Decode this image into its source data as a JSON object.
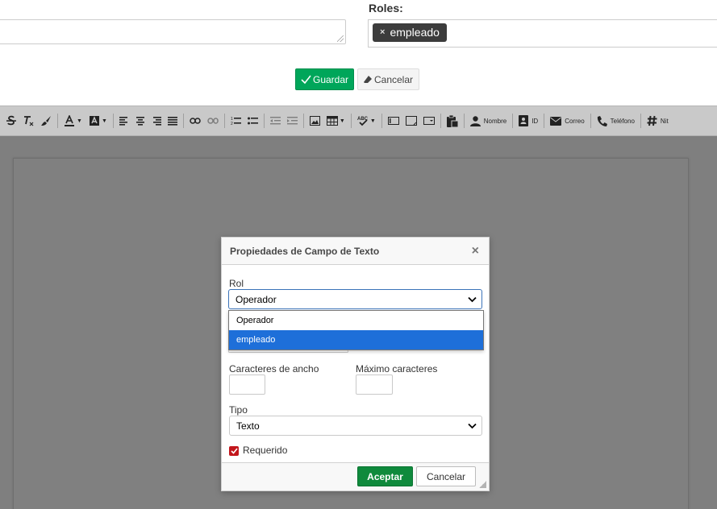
{
  "form": {
    "roles_label": "Roles:",
    "role_tag": {
      "remove": "×",
      "label": "empleado"
    },
    "save_label": "Guardar",
    "cancel_label": "Cancelar"
  },
  "toolbar": {
    "items": [
      {
        "icon": "strikethrough-icon"
      },
      {
        "icon": "remove-format-icon"
      },
      {
        "icon": "copy-format-icon"
      },
      {
        "icon": "text-color-icon"
      },
      {
        "icon": "background-color-icon"
      },
      {
        "icon": "align-left-icon"
      },
      {
        "icon": "align-center-icon"
      },
      {
        "icon": "align-right-icon"
      },
      {
        "icon": "align-justify-icon"
      },
      {
        "icon": "link-icon"
      },
      {
        "icon": "unlink-icon"
      },
      {
        "icon": "numbered-list-icon"
      },
      {
        "icon": "bulleted-list-icon"
      },
      {
        "icon": "decrease-indent-icon"
      },
      {
        "icon": "increase-indent-icon"
      },
      {
        "icon": "image-icon"
      },
      {
        "icon": "table-icon"
      },
      {
        "icon": "spellcheck-icon"
      },
      {
        "icon": "text-field-icon"
      },
      {
        "icon": "textarea-icon"
      },
      {
        "icon": "select-field-icon"
      },
      {
        "icon": "paste-icon"
      }
    ],
    "labeled": {
      "nombre": "Nombre",
      "id": "ID",
      "correo": "Correo",
      "telefono": "Teléfono",
      "nit": "Nit"
    }
  },
  "dialog": {
    "title": "Propiedades de Campo de Texto",
    "close": "×",
    "rol_label": "Rol",
    "rol_value": "Operador",
    "rol_options": [
      "Operador",
      "empleado"
    ],
    "rol_highlighted": "empleado",
    "width_label": "Caracteres de ancho",
    "max_label": "Máximo caracteres",
    "tipo_label": "Tipo",
    "tipo_value": "Texto",
    "required_label": "Requerido",
    "required_checked": true,
    "accept_label": "Aceptar",
    "cancel_label": "Cancelar"
  },
  "colors": {
    "save_green": "#00a65a",
    "accept_green": "#0f8a3c",
    "highlight_blue": "#1e6fd9",
    "checkbox_red": "#c2161c"
  }
}
